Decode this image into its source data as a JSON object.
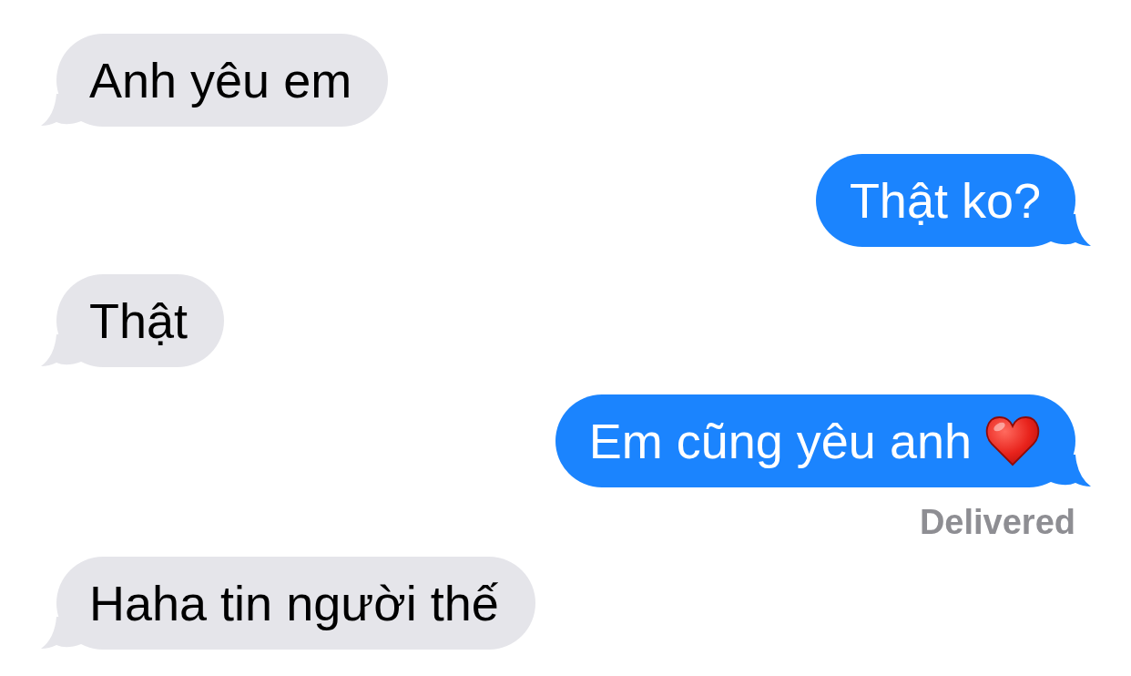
{
  "messages": [
    {
      "kind": "received",
      "text": "Anh yêu em"
    },
    {
      "kind": "sent",
      "text": "Thật ko?"
    },
    {
      "kind": "received",
      "text": "Thật"
    },
    {
      "kind": "sent",
      "text": "Em cũng yêu anh",
      "emoji": true,
      "status": "Delivered"
    },
    {
      "kind": "received",
      "text": "Haha tin người thế"
    }
  ]
}
